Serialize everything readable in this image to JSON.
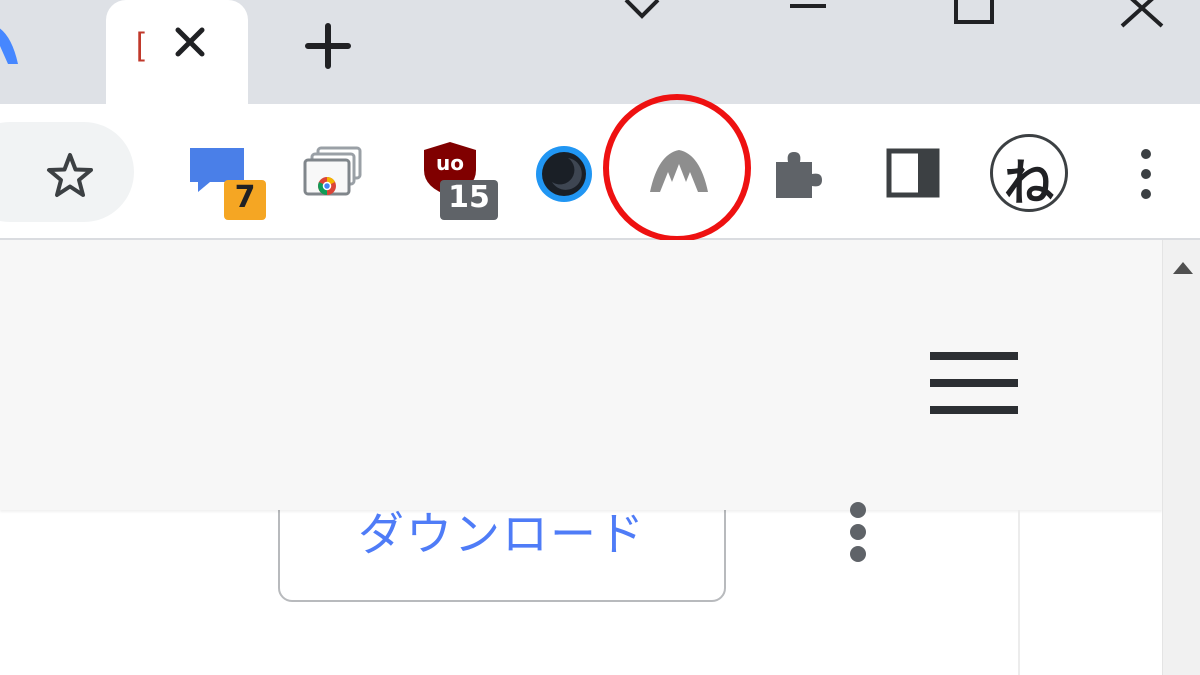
{
  "tabs": {
    "active_title_fragment": "[",
    "close_icon": "close-icon",
    "new_tab_icon": "plus-icon"
  },
  "window_controls": [
    "chevron-down-icon",
    "minimize-icon",
    "maximize-icon",
    "close-icon"
  ],
  "toolbar": {
    "bookmark_icon": "star-icon",
    "extensions": [
      {
        "name": "chat-extension",
        "badge": "7"
      },
      {
        "name": "chrome-tabs-extension",
        "badge": ""
      },
      {
        "name": "ublock-origin-extension",
        "icon_text": "uo",
        "badge": "15"
      },
      {
        "name": "dark-mode-extension",
        "badge": ""
      },
      {
        "name": "nordvpn-extension",
        "badge": "",
        "highlighted": true
      },
      {
        "name": "puzzle-extensions-menu",
        "badge": ""
      },
      {
        "name": "side-panel-toggle",
        "badge": ""
      },
      {
        "name": "profile-avatar",
        "icon_text": "ね",
        "badge": ""
      },
      {
        "name": "chrome-menu",
        "badge": ""
      }
    ],
    "highlight_color": "#ee1111",
    "badge_colors": {
      "chat": "#f5a623",
      "ublock": "#5f6368"
    }
  },
  "page": {
    "menu_icon": "hamburger-icon",
    "download_button_label": "ダウンロード",
    "more_icon": "kebab-vertical-icon",
    "accent_color": "#4f7cf7"
  }
}
